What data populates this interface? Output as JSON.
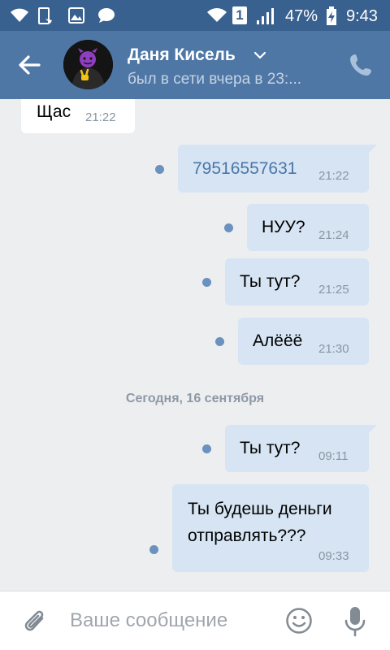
{
  "status_bar": {
    "battery": "47%",
    "time": "9:43",
    "sim_slot": "1",
    "icons_left": [
      "wifi-icon",
      "phone-screen-icon",
      "image-icon",
      "chat-bubble-icon"
    ],
    "icons_right": [
      "wifi-icon",
      "sim-1-icon",
      "signal-icon",
      "battery-charging-icon"
    ]
  },
  "header": {
    "name": "Даня Кисель",
    "status": "был в сети вчера в 23:...",
    "color": "#4e77a6"
  },
  "messages": [
    {
      "dir": "in",
      "text": "Щас",
      "time": "21:22"
    },
    {
      "dir": "out",
      "text": "79516557631",
      "time": "21:22",
      "is_link": true
    },
    {
      "dir": "out",
      "text": "НУУ?",
      "time": "21:24"
    },
    {
      "dir": "out",
      "text": "Ты тут?",
      "time": "21:25"
    },
    {
      "dir": "out",
      "text": "Алёёё",
      "time": "21:30"
    },
    {
      "date_separator": "Сегодня, 16 сентября"
    },
    {
      "dir": "out",
      "text": "Ты тут?",
      "time": "09:11"
    },
    {
      "dir": "out",
      "text_line1": "Ты будешь деньги",
      "text_line2": "отправлять???",
      "time": "09:33"
    }
  ],
  "composer": {
    "placeholder": "Ваше сообщение"
  },
  "colors": {
    "status_bar": "#39618f",
    "header": "#4e77a6",
    "outgoing_bubble": "#d6e4f3",
    "incoming_bubble": "#ffffff",
    "unread_dot": "#6b91bf",
    "link": "#4a76a8"
  }
}
